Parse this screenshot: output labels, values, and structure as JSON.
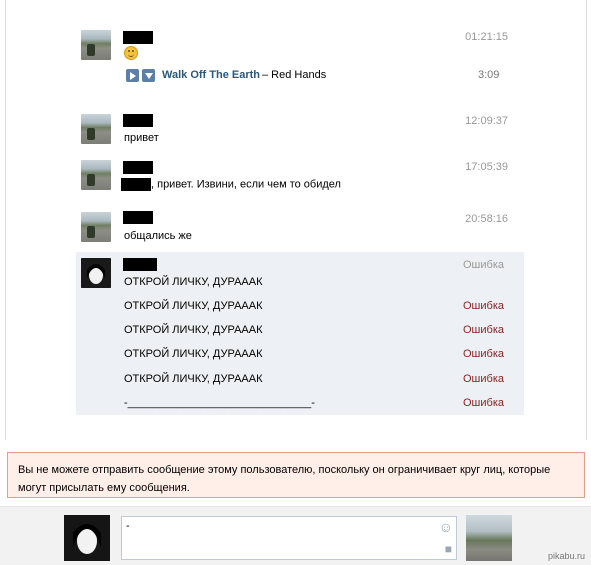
{
  "messages": [
    {
      "time": "01:21:15",
      "emoji": "smile-emoji",
      "audio": {
        "artist": "Walk Off The Earth",
        "title": " – Red Hands",
        "duration": "3:09"
      }
    },
    {
      "time": "12:09:37",
      "text": "привет"
    },
    {
      "time": "17:05:39",
      "text": ", привет. Извини, если чем то обидел"
    },
    {
      "time": "20:58:16",
      "text": "общались же"
    }
  ],
  "failed_group": {
    "rows": [
      {
        "text": "ОТКРОЙ ЛИЧКУ, ДУРАААК",
        "status": "Ошибка"
      },
      {
        "text": "ОТКРОЙ ЛИЧКУ, ДУРАААК",
        "status": "Ошибка"
      },
      {
        "text": "ОТКРОЙ ЛИЧКУ, ДУРАААК",
        "status": "Ошибка"
      },
      {
        "text": "ОТКРОЙ ЛИЧКУ, ДУРАААК",
        "status": "Ошибка"
      },
      {
        "text": "ОТКРОЙ ЛИЧКУ, ДУРАААК",
        "status": "Ошибка"
      },
      {
        "text": "-______________________________-",
        "status": "Ошибка"
      }
    ]
  },
  "warning": {
    "text": "Вы не можете отправить сообщение этому пользователю, поскольку он ограничивает круг лиц, которые могут присылать ему сообщения."
  },
  "composer": {
    "value": "-"
  },
  "watermark": "pikabu.ru",
  "colors": {
    "link": "#2b587a",
    "error": "#8b1f1f",
    "muted": "#999999",
    "warn_bg": "#ffefe8",
    "warn_border": "#e89b88"
  },
  "icons": {
    "play": "play-icon",
    "download": "download-icon",
    "smile": "smile-icon",
    "camera": "camera-icon"
  }
}
